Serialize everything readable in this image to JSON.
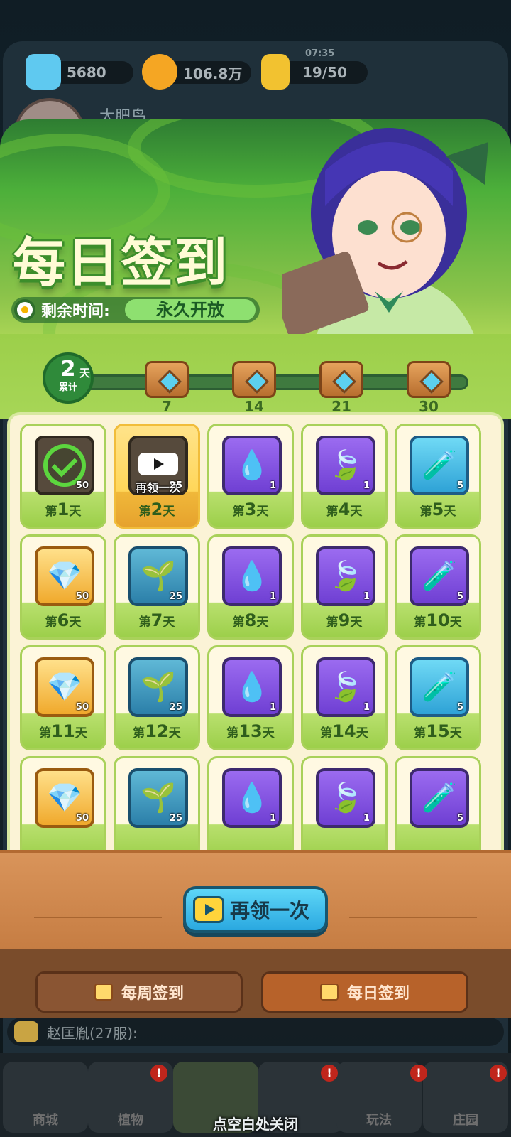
{
  "resources": {
    "gems": "5680",
    "coins": "106.8万",
    "energy": "19/50",
    "energy_timer": "07:35"
  },
  "profile": {
    "name": "大肥鸟"
  },
  "banner": {
    "title": "每日签到",
    "remaining_label": "剩余时间:",
    "remaining_value": "永久开放"
  },
  "progress": {
    "days": "2",
    "days_unit": "天",
    "cumulative_label": "累计",
    "milestones": [
      "7",
      "14",
      "21",
      "30"
    ]
  },
  "grid": [
    {
      "day_prefix": "第",
      "day": "1",
      "day_suffix": "天",
      "icon": "check-icon",
      "qty": "50",
      "state": "claimed"
    },
    {
      "day_prefix": "第",
      "day": "2",
      "day_suffix": "天",
      "icon": "video-icon",
      "qty": "25",
      "state": "today",
      "overlay": "再领一次"
    },
    {
      "day_prefix": "第",
      "day": "3",
      "day_suffix": "天",
      "icon": "droplet-icon",
      "qty": "1",
      "box": "purple"
    },
    {
      "day_prefix": "第",
      "day": "4",
      "day_suffix": "天",
      "icon": "leaf-icon",
      "qty": "1",
      "box": "purple"
    },
    {
      "day_prefix": "第",
      "day": "5",
      "day_suffix": "天",
      "icon": "potion-icon",
      "qty": "5",
      "box": "blue"
    },
    {
      "day_prefix": "第",
      "day": "6",
      "day_suffix": "天",
      "icon": "diamond-icon",
      "qty": "50",
      "box": "gold"
    },
    {
      "day_prefix": "第",
      "day": "7",
      "day_suffix": "天",
      "icon": "seed-icon",
      "qty": "25",
      "box": "teal"
    },
    {
      "day_prefix": "第",
      "day": "8",
      "day_suffix": "天",
      "icon": "droplet-icon",
      "qty": "1",
      "box": "purple"
    },
    {
      "day_prefix": "第",
      "day": "9",
      "day_suffix": "天",
      "icon": "leaf-icon",
      "qty": "1",
      "box": "purple"
    },
    {
      "day_prefix": "第",
      "day": "10",
      "day_suffix": "天",
      "icon": "potion-icon",
      "qty": "5",
      "box": "purple"
    },
    {
      "day_prefix": "第",
      "day": "11",
      "day_suffix": "天",
      "icon": "diamond-icon",
      "qty": "50",
      "box": "gold"
    },
    {
      "day_prefix": "第",
      "day": "12",
      "day_suffix": "天",
      "icon": "seed-icon",
      "qty": "25",
      "box": "teal"
    },
    {
      "day_prefix": "第",
      "day": "13",
      "day_suffix": "天",
      "icon": "droplet-icon",
      "qty": "1",
      "box": "purple"
    },
    {
      "day_prefix": "第",
      "day": "14",
      "day_suffix": "天",
      "icon": "leaf-icon",
      "qty": "1",
      "box": "purple"
    },
    {
      "day_prefix": "第",
      "day": "15",
      "day_suffix": "天",
      "icon": "potion-icon",
      "qty": "5",
      "box": "blue"
    },
    {
      "day_prefix": "",
      "day": "",
      "day_suffix": "",
      "icon": "diamond-icon",
      "qty": "50",
      "box": "gold"
    },
    {
      "day_prefix": "",
      "day": "",
      "day_suffix": "",
      "icon": "seed-icon",
      "qty": "25",
      "box": "teal"
    },
    {
      "day_prefix": "",
      "day": "",
      "day_suffix": "",
      "icon": "droplet-icon",
      "qty": "1",
      "box": "purple"
    },
    {
      "day_prefix": "",
      "day": "",
      "day_suffix": "",
      "icon": "leaf-icon",
      "qty": "1",
      "box": "purple"
    },
    {
      "day_prefix": "",
      "day": "",
      "day_suffix": "",
      "icon": "potion-icon",
      "qty": "5",
      "box": "purple"
    }
  ],
  "actions": {
    "claim_again": "再领一次"
  },
  "tabs": {
    "weekly": "每周签到",
    "daily": "每日签到"
  },
  "chat": {
    "text": "赵匡胤(27服):"
  },
  "nav": [
    "商城",
    "植物",
    "",
    "",
    "玩法",
    "庄园"
  ],
  "close_hint": "点空白处关闭"
}
